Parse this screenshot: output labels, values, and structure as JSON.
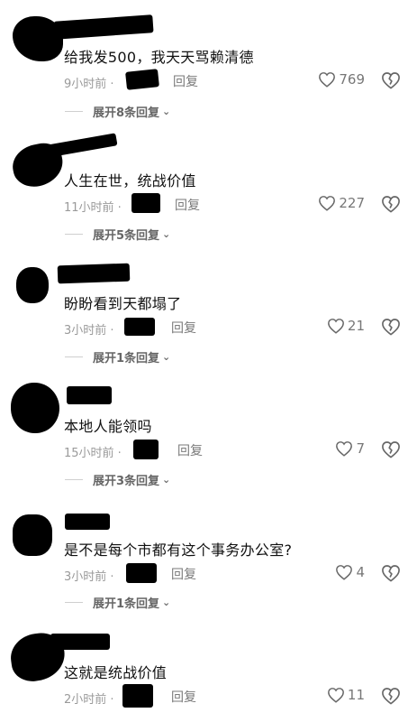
{
  "comments": [
    {
      "text": "给我发500，我天天骂赖清德",
      "time": "9小时前 ·",
      "reply": "回复",
      "likes": "769",
      "expand": "展开8条回复"
    },
    {
      "text": "人生在世，统战价值",
      "time": "11小时前 ·",
      "reply": "回复",
      "likes": "227",
      "expand": "展开5条回复"
    },
    {
      "text": "盼盼看到天都塌了",
      "time": "3小时前 ·",
      "reply": "回复",
      "likes": "21",
      "expand": "展开1条回复"
    },
    {
      "text": "本地人能领吗",
      "time": "15小时前 ·",
      "reply": "回复",
      "likes": "7",
      "expand": "展开3条回复"
    },
    {
      "text": "是不是每个市都有这个事务办公室?",
      "time": "3小时前 ·",
      "reply": "回复",
      "likes": "4",
      "expand": "展开1条回复"
    },
    {
      "text": "这就是统战价值",
      "time": "2小时前 ·",
      "reply": "回复",
      "likes": "11"
    }
  ],
  "icons": {
    "like": "heart-outline-icon",
    "dislike": "broken-heart-icon",
    "expand": "chevron-down-icon"
  }
}
